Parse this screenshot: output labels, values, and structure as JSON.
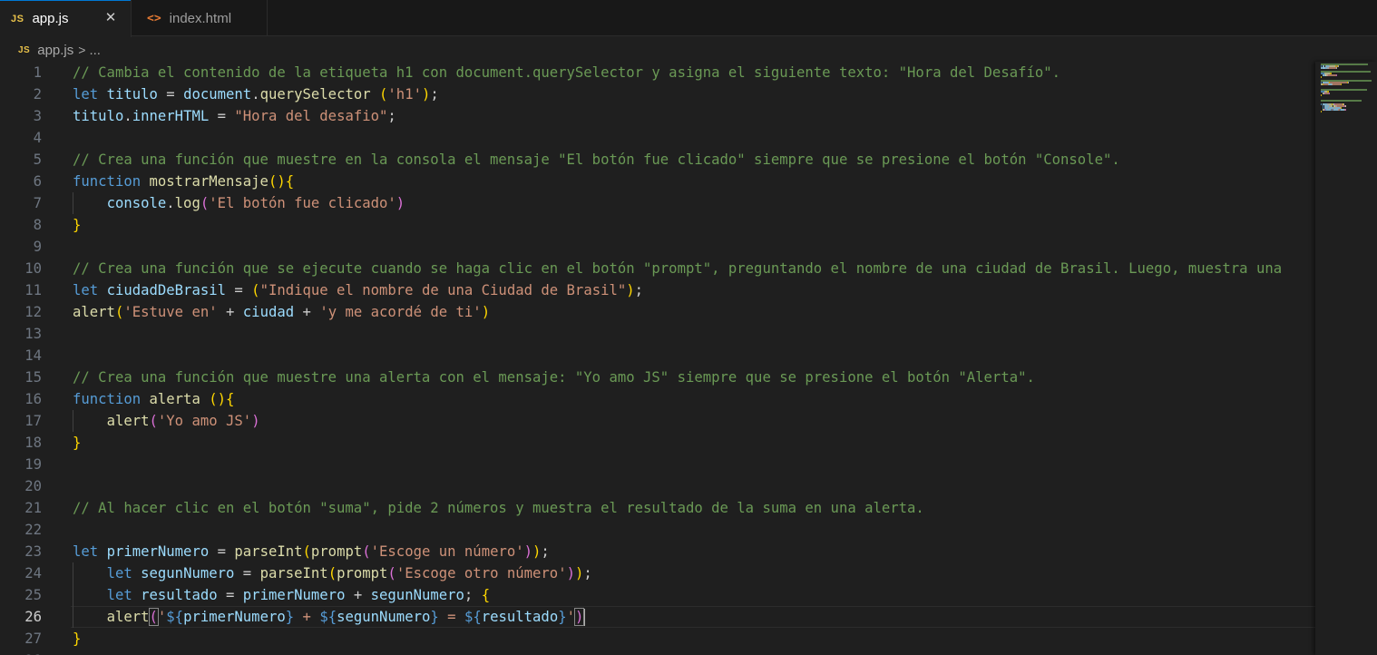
{
  "tabs": [
    {
      "label": "app.js",
      "icon": "js-file-icon",
      "icon_text": "JS",
      "active": true,
      "close_glyph": "✕"
    },
    {
      "label": "index.html",
      "icon": "html-file-icon",
      "icon_text": "<>",
      "active": false
    }
  ],
  "breadcrumb": {
    "icon_text": "JS",
    "file": "app.js",
    "separator": ">",
    "rest": "..."
  },
  "colors": {
    "comment": "#6a9955",
    "keyword": "#569cd6",
    "variable": "#9cdcfe",
    "function": "#dcdcaa",
    "string": "#ce9178",
    "bracket1": "#ffd700",
    "bracket2": "#da70d6",
    "bracket3": "#179fff"
  },
  "active_line": 26,
  "lines": [
    [
      {
        "t": "// Cambia el contenido de la etiqueta h1 con document.querySelector y asigna el siguiente texto: \"Hora del Desafío\".",
        "c": "cm"
      }
    ],
    [
      {
        "t": "let",
        "c": "kw"
      },
      {
        "t": " "
      },
      {
        "t": "titulo",
        "c": "var"
      },
      {
        "t": " = "
      },
      {
        "t": "document",
        "c": "var"
      },
      {
        "t": "."
      },
      {
        "t": "querySelector",
        "c": "fn"
      },
      {
        "t": " "
      },
      {
        "t": "(",
        "c": "b1"
      },
      {
        "t": "'h1'",
        "c": "str"
      },
      {
        "t": ")",
        "c": "b1"
      },
      {
        "t": ";"
      }
    ],
    [
      {
        "t": "titulo",
        "c": "var"
      },
      {
        "t": "."
      },
      {
        "t": "innerHTML",
        "c": "var"
      },
      {
        "t": " = "
      },
      {
        "t": "\"Hora del desafio\"",
        "c": "str"
      },
      {
        "t": ";"
      }
    ],
    [],
    [
      {
        "t": "// Crea una función que muestre en la consola el mensaje \"El botón fue clicado\" siempre que se presione el botón \"Console\".",
        "c": "cm"
      }
    ],
    [
      {
        "t": "function",
        "c": "kw"
      },
      {
        "t": " "
      },
      {
        "t": "mostrarMensaje",
        "c": "fn"
      },
      {
        "t": "(){",
        "c": "b1"
      }
    ],
    [
      {
        "t": "    "
      },
      {
        "t": "console",
        "c": "var"
      },
      {
        "t": "."
      },
      {
        "t": "log",
        "c": "fn"
      },
      {
        "t": "(",
        "c": "b2"
      },
      {
        "t": "'El botón fue clicado'",
        "c": "str"
      },
      {
        "t": ")",
        "c": "b2"
      }
    ],
    [
      {
        "t": "}",
        "c": "b1"
      }
    ],
    [],
    [
      {
        "t": "// Crea una función que se ejecute cuando se haga clic en el botón \"prompt\", preguntando el nombre de una ciudad de Brasil. Luego, muestra una",
        "c": "cm"
      }
    ],
    [
      {
        "t": "let",
        "c": "kw"
      },
      {
        "t": " "
      },
      {
        "t": "ciudadDeBrasil",
        "c": "var"
      },
      {
        "t": " = "
      },
      {
        "t": "(",
        "c": "b1"
      },
      {
        "t": "\"Indique el nombre de una Ciudad de Brasil\"",
        "c": "str"
      },
      {
        "t": ")",
        "c": "b1"
      },
      {
        "t": ";"
      }
    ],
    [
      {
        "t": "alert",
        "c": "fn"
      },
      {
        "t": "(",
        "c": "b1"
      },
      {
        "t": "'Estuve en'",
        "c": "str"
      },
      {
        "t": " + "
      },
      {
        "t": "ciudad",
        "c": "var"
      },
      {
        "t": " + "
      },
      {
        "t": "'y me acordé de ti'",
        "c": "str"
      },
      {
        "t": ")",
        "c": "b1"
      }
    ],
    [],
    [],
    [
      {
        "t": "// Crea una función que muestre una alerta con el mensaje: \"Yo amo JS\" siempre que se presione el botón \"Alerta\".",
        "c": "cm"
      }
    ],
    [
      {
        "t": "function",
        "c": "kw"
      },
      {
        "t": " "
      },
      {
        "t": "alerta",
        "c": "fn"
      },
      {
        "t": " "
      },
      {
        "t": "(){",
        "c": "b1"
      }
    ],
    [
      {
        "t": "    "
      },
      {
        "t": "alert",
        "c": "fn"
      },
      {
        "t": "(",
        "c": "b2"
      },
      {
        "t": "'Yo amo JS'",
        "c": "str"
      },
      {
        "t": ")",
        "c": "b2"
      }
    ],
    [
      {
        "t": "}",
        "c": "b1"
      }
    ],
    [],
    [],
    [
      {
        "t": "// Al hacer clic en el botón \"suma\", pide 2 números y muestra el resultado de la suma en una alerta.",
        "c": "cm"
      }
    ],
    [],
    [
      {
        "t": "let",
        "c": "kw"
      },
      {
        "t": " "
      },
      {
        "t": "primerNumero",
        "c": "var"
      },
      {
        "t": " = "
      },
      {
        "t": "parseInt",
        "c": "fn"
      },
      {
        "t": "(",
        "c": "b1"
      },
      {
        "t": "prompt",
        "c": "fn"
      },
      {
        "t": "(",
        "c": "b2"
      },
      {
        "t": "'Escoge un número'",
        "c": "str"
      },
      {
        "t": ")",
        "c": "b2"
      },
      {
        "t": ")",
        "c": "b1"
      },
      {
        "t": ";"
      }
    ],
    [
      {
        "t": "    "
      },
      {
        "t": "let",
        "c": "kw"
      },
      {
        "t": " "
      },
      {
        "t": "segunNumero",
        "c": "var"
      },
      {
        "t": " = "
      },
      {
        "t": "parseInt",
        "c": "fn"
      },
      {
        "t": "(",
        "c": "b1"
      },
      {
        "t": "prompt",
        "c": "fn"
      },
      {
        "t": "(",
        "c": "b2"
      },
      {
        "t": "'Escoge otro número'",
        "c": "str"
      },
      {
        "t": ")",
        "c": "b2"
      },
      {
        "t": ")",
        "c": "b1"
      },
      {
        "t": ";"
      }
    ],
    [
      {
        "t": "    "
      },
      {
        "t": "let",
        "c": "kw"
      },
      {
        "t": " "
      },
      {
        "t": "resultado",
        "c": "var"
      },
      {
        "t": " = "
      },
      {
        "t": "primerNumero",
        "c": "var"
      },
      {
        "t": " + "
      },
      {
        "t": "segunNumero",
        "c": "var"
      },
      {
        "t": "; "
      },
      {
        "t": "{",
        "c": "b1"
      }
    ],
    [
      {
        "t": "    "
      },
      {
        "t": "alert",
        "c": "fn"
      },
      {
        "t": "(",
        "c": "b2 bm"
      },
      {
        "t": "'",
        "c": "str"
      },
      {
        "t": "${",
        "c": "kw"
      },
      {
        "t": "primerNumero",
        "c": "tvar"
      },
      {
        "t": "}",
        "c": "kw"
      },
      {
        "t": " + ",
        "c": "str"
      },
      {
        "t": "${",
        "c": "kw"
      },
      {
        "t": "segunNumero",
        "c": "tvar"
      },
      {
        "t": "}",
        "c": "kw"
      },
      {
        "t": " = ",
        "c": "str"
      },
      {
        "t": "${",
        "c": "kw"
      },
      {
        "t": "resultado",
        "c": "tvar"
      },
      {
        "t": "}",
        "c": "kw"
      },
      {
        "t": "'",
        "c": "str"
      },
      {
        "t": ")",
        "c": "b2 bm"
      }
    ],
    [
      {
        "t": "}",
        "c": "b1"
      }
    ],
    []
  ]
}
